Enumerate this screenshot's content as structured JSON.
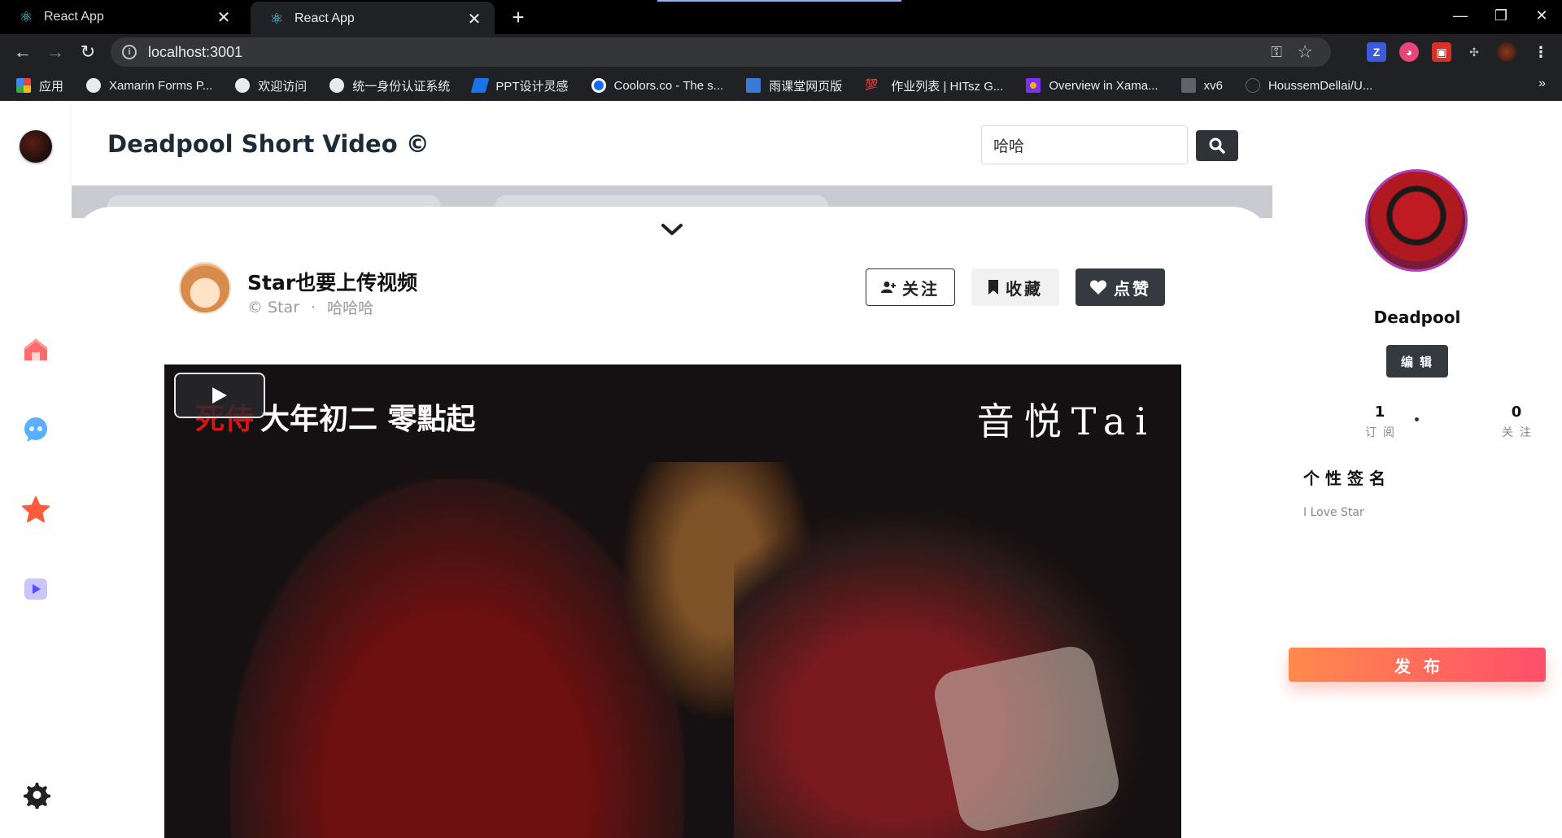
{
  "browser": {
    "tabs": [
      {
        "title": "React App",
        "active": false
      },
      {
        "title": "React App",
        "active": true
      }
    ],
    "url": "localhost:3001",
    "bookmarks": [
      {
        "label": "应用",
        "icon": "apps-grid-icon",
        "color": "#ea4335"
      },
      {
        "label": "Xamarin Forms P...",
        "icon": "globe-icon",
        "color": "#e8eaed"
      },
      {
        "label": "欢迎访问",
        "icon": "globe-icon",
        "color": "#e8eaed"
      },
      {
        "label": "统一身份认证系统",
        "icon": "globe-icon",
        "color": "#e8eaed"
      },
      {
        "label": "PPT设计灵感",
        "icon": "feather-icon",
        "color": "#1a73e8"
      },
      {
        "label": "Coolors.co - The s...",
        "icon": "coolors-icon",
        "color": "#0d6efd"
      },
      {
        "label": "雨课堂网页版",
        "icon": "rain-class-icon",
        "color": "#3a7bd5"
      },
      {
        "label": "作业列表 | HITsz G...",
        "icon": "hundred-icon",
        "color": "#e53935"
      },
      {
        "label": "Overview in Xama...",
        "icon": "dots-icon",
        "color": "#f4b400"
      },
      {
        "label": "xv6",
        "icon": "pdos-icon",
        "color": "#9aa0a6"
      },
      {
        "label": "HoussemDellai/U...",
        "icon": "github-icon",
        "color": "#202124"
      }
    ]
  },
  "app": {
    "title": "Deadpool Short Video ©",
    "search": {
      "value": "哈哈"
    }
  },
  "video": {
    "title": "Star也要上传视频",
    "author": "© Star",
    "separator": "·",
    "tag": "哈哈哈",
    "overlay_red": "死侍",
    "overlay_text": "大年初二 零點起",
    "overlay_logo": "音悦Tai",
    "buttons": {
      "follow": "关注",
      "collect": "收藏",
      "like": "点赞"
    }
  },
  "profile": {
    "name": "Deadpool",
    "edit_label": "编辑",
    "subscriptions": {
      "count": "1",
      "label": "订阅"
    },
    "following": {
      "count": "0",
      "label": "关注"
    },
    "signature_title": "个性签名",
    "signature": "I Love Star",
    "publish_label": "发布"
  },
  "colors": {
    "accent_dark": "#343a40",
    "publish_gradient_start": "#ff8a4c",
    "publish_gradient_end": "#ff4f6a"
  }
}
